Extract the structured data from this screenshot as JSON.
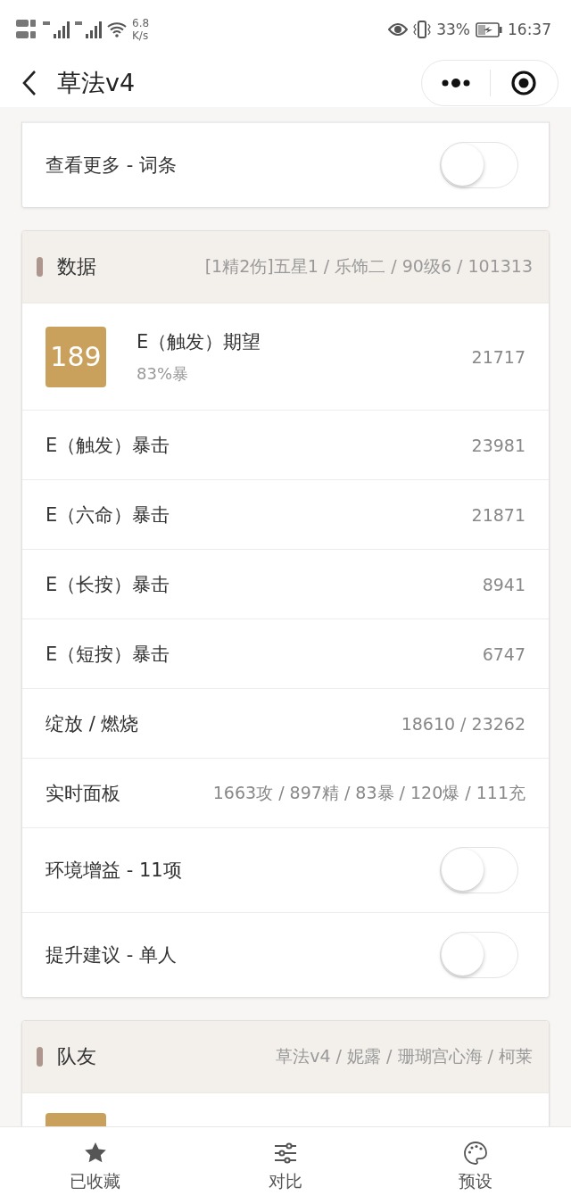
{
  "status_bar": {
    "speed": "6.8",
    "speed_unit": "K/s",
    "battery": "33%",
    "time": "16:37"
  },
  "nav": {
    "title": "草法v4"
  },
  "cards": [
    {
      "rows": [
        {
          "kind": "toggle",
          "label": "查看更多 - 词条",
          "on": false
        }
      ]
    },
    {
      "title": "数据",
      "summary": "[1精2伤]五星1 / 乐饰二 / 90级6 / 101313",
      "rows": [
        {
          "kind": "hero",
          "badge": "189",
          "label": "E（触发）期望",
          "sub": "83%暴",
          "value": "21717"
        },
        {
          "kind": "value",
          "label": "E（触发）暴击",
          "value": "23981"
        },
        {
          "kind": "value",
          "label": "E（六命）暴击",
          "value": "21871"
        },
        {
          "kind": "value",
          "label": "E（长按）暴击",
          "value": "8941"
        },
        {
          "kind": "value",
          "label": "E（短按）暴击",
          "value": "6747"
        },
        {
          "kind": "value",
          "label": "绽放 / 燃烧",
          "value": "18610 / 23262"
        },
        {
          "kind": "value",
          "label": "实时面板",
          "value": "1663攻 / 897精 / 83暴 / 120爆 / 111充"
        },
        {
          "kind": "toggle",
          "label": "环境增益 - 11项",
          "on": false
        },
        {
          "kind": "toggle",
          "label": "提升建议 - 单人",
          "on": false
        }
      ]
    },
    {
      "title": "队友",
      "summary": "草法v4 / 妮露 / 珊瑚宫心海 / 柯莱",
      "rows": [
        {
          "kind": "hero"
        }
      ]
    }
  ],
  "tabs": [
    {
      "kind": "star",
      "label": "已收藏"
    },
    {
      "kind": "sliders",
      "label": "对比"
    },
    {
      "kind": "palette",
      "label": "预设"
    }
  ]
}
